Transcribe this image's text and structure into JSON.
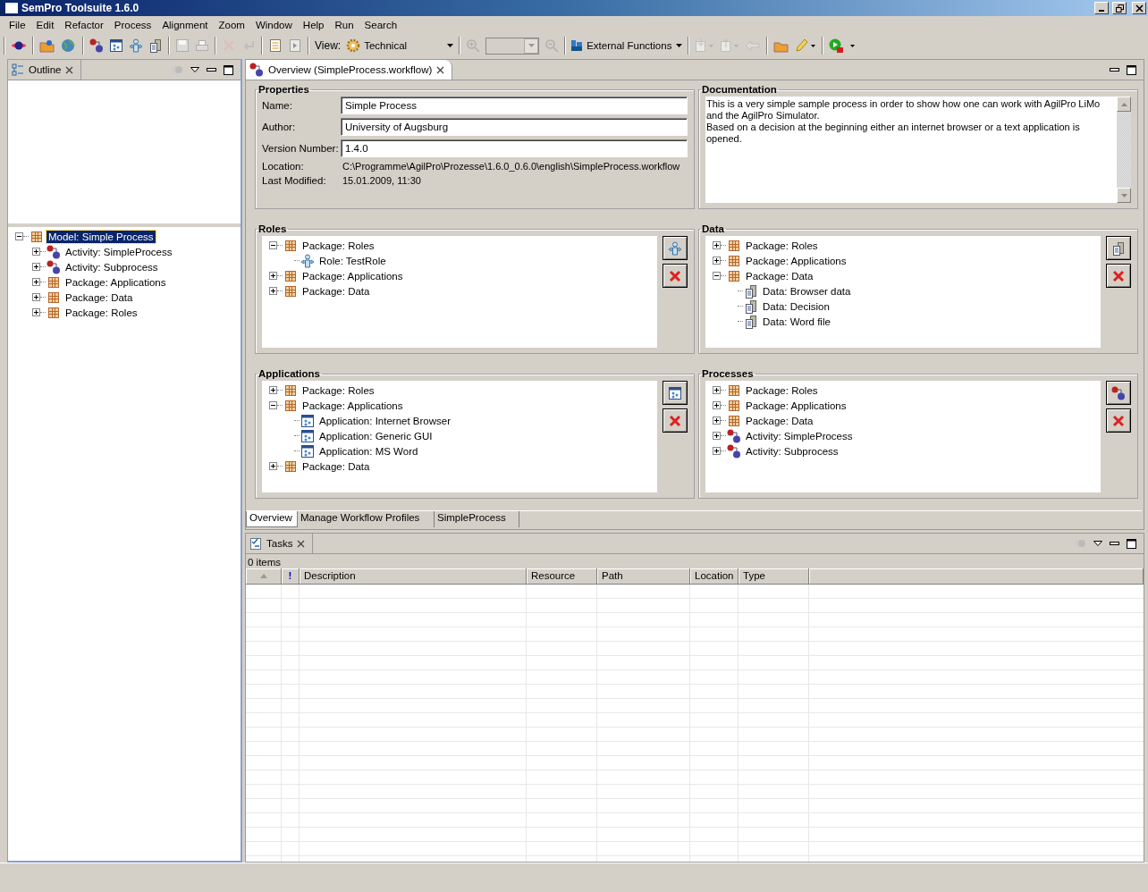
{
  "window": {
    "title": "SemPro Toolsuite 1.6.0"
  },
  "menu": [
    "File",
    "Edit",
    "Refactor",
    "Process",
    "Alignment",
    "Zoom",
    "Window",
    "Help",
    "Run",
    "Search"
  ],
  "toolbar": {
    "view_label": "View:",
    "view_value": "Technical",
    "external": "External Functions"
  },
  "outline": {
    "tab": "Outline",
    "tree": [
      {
        "kind": "model",
        "label": "Model: Simple Process",
        "expanded": true,
        "selected": true,
        "children": [
          {
            "kind": "activity",
            "label": "Activity: SimpleProcess",
            "expanded": false,
            "selected": false
          },
          {
            "kind": "activity",
            "label": "Activity: Subprocess",
            "expanded": false,
            "selected": false
          },
          {
            "kind": "package",
            "label": "Package: Applications",
            "expanded": false,
            "selected": false
          },
          {
            "kind": "package",
            "label": "Package: Data",
            "expanded": false,
            "selected": false
          },
          {
            "kind": "package",
            "label": "Package: Roles",
            "expanded": false,
            "selected": false
          }
        ]
      }
    ]
  },
  "editor": {
    "tab": "Overview (SimpleProcess.workflow)",
    "properties": {
      "title": "Properties",
      "fields": [
        {
          "kind": "input",
          "label": "Name:",
          "value": "Simple Process"
        },
        {
          "kind": "input",
          "label": "Author:",
          "value": "University of Augsburg"
        },
        {
          "kind": "input",
          "label": "Version Number:",
          "value": "1.4.0"
        },
        {
          "kind": "text",
          "label": "Location:",
          "value": "C:\\Programme\\AgilPro\\Prozesse\\1.6.0_0.6.0\\english\\SimpleProcess.workflow"
        },
        {
          "kind": "text",
          "label": "Last Modified:",
          "value": "15.01.2009, 11:30"
        }
      ]
    },
    "documentation": {
      "title": "Documentation",
      "text": "This is a very simple sample process in order to show how one can work with AgilPro LiMo and the AgilPro Simulator.\nBased on a decision at the beginning either an internet browser or a text application is opened."
    },
    "sections": [
      {
        "title": "Roles",
        "kind": "role",
        "tree": [
          {
            "kind": "package",
            "label": "Package: Roles",
            "expanded": true,
            "children": [
              {
                "kind": "role",
                "label": "Role: TestRole"
              }
            ]
          },
          {
            "kind": "package",
            "label": "Package: Applications",
            "expanded": false
          },
          {
            "kind": "package",
            "label": "Package: Data",
            "expanded": false
          }
        ]
      },
      {
        "title": "Data",
        "kind": "data",
        "tree": [
          {
            "kind": "package",
            "label": "Package: Roles",
            "expanded": false
          },
          {
            "kind": "package",
            "label": "Package: Applications",
            "expanded": false
          },
          {
            "kind": "package",
            "label": "Package: Data",
            "expanded": true,
            "children": [
              {
                "kind": "data",
                "label": "Data: Browser data"
              },
              {
                "kind": "data",
                "label": "Data: Decision"
              },
              {
                "kind": "data",
                "label": "Data: Word file"
              }
            ]
          }
        ]
      },
      {
        "title": "Applications",
        "kind": "application",
        "tree": [
          {
            "kind": "package",
            "label": "Package: Roles",
            "expanded": false
          },
          {
            "kind": "package",
            "label": "Package: Applications",
            "expanded": true,
            "children": [
              {
                "kind": "application",
                "label": "Application: Internet Browser"
              },
              {
                "kind": "application",
                "label": "Application: Generic GUI"
              },
              {
                "kind": "application",
                "label": "Application: MS Word"
              }
            ]
          },
          {
            "kind": "package",
            "label": "Package: Data",
            "expanded": false
          }
        ]
      },
      {
        "title": "Processes",
        "kind": "activity",
        "tree": [
          {
            "kind": "package",
            "label": "Package: Roles",
            "expanded": false
          },
          {
            "kind": "package",
            "label": "Package: Applications",
            "expanded": false
          },
          {
            "kind": "package",
            "label": "Package: Data",
            "expanded": false
          },
          {
            "kind": "activity",
            "label": "Activity: SimpleProcess",
            "expanded": false
          },
          {
            "kind": "activity",
            "label": "Activity: Subprocess",
            "expanded": false
          }
        ]
      }
    ],
    "bottom_tabs": [
      {
        "label": "Overview",
        "selected": true
      },
      {
        "label": "Manage Workflow Profiles",
        "selected": false
      },
      {
        "label": "SimpleProcess",
        "selected": false
      }
    ]
  },
  "tasks": {
    "tab": "Tasks",
    "count": "0 items",
    "columns": [
      "!",
      "Description",
      "Resource",
      "Path",
      "Location",
      "Type"
    ]
  }
}
